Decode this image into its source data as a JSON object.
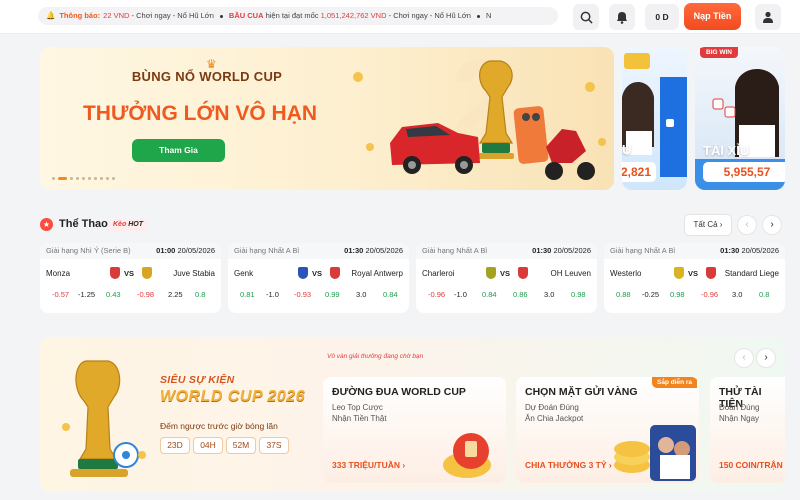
{
  "topbar": {
    "ticker": [
      {
        "label": "Thông báo:",
        "amount": "22 VND",
        "suffix": "- Chơi ngay - Nổ Hũ Lớn"
      },
      {
        "label": "BẦU CUA",
        "middle": " hiện tại đạt mốc ",
        "amount": "1,051,242,762 VND",
        "suffix": "- Chơi ngay - Nổ Hũ Lớn"
      },
      {
        "tail": "N"
      }
    ],
    "balance": "0 D",
    "deposit_label": "Nạp Tiền"
  },
  "hero": {
    "title1": "BÙNG NỔ WORLD CUP",
    "title2": "THƯỞNG LỚN VÔ HẠN",
    "cta": "Tham Gia",
    "dots": 10,
    "active_dot": 1
  },
  "side_banners": [
    {
      "title": "U",
      "amount": "2,821"
    },
    {
      "badge": "BIG WIN",
      "title": "TÀI XỈU",
      "amount": "5,955,57"
    }
  ],
  "sports": {
    "title": "Thể Thao",
    "badge_keo": "Kèo",
    "badge_hot": "HOT",
    "see_all": "Tất Cả",
    "matches": [
      {
        "league": "Giải hạng Nhì Ý (Serie B)",
        "time": "01:00",
        "date": "20/05/2026",
        "home": "Monza",
        "away": "Juve Stabia",
        "home_color": "#d93a3a",
        "away_color": "#d9a421",
        "odds": [
          "-0.57",
          "-1.25",
          "0.43",
          "-0.98",
          "2.25",
          "0.8"
        ]
      },
      {
        "league": "Giải hạng Nhất A Bỉ",
        "time": "01:30",
        "date": "20/05/2026",
        "home": "Genk",
        "away": "Royal Antwerp",
        "home_color": "#2a55b8",
        "away_color": "#d93a3a",
        "odds": [
          "0.81",
          "-1.0",
          "-0.93",
          "0.99",
          "3.0",
          "0.84"
        ]
      },
      {
        "league": "Giải hạng Nhất A Bỉ",
        "time": "01:30",
        "date": "20/05/2026",
        "home": "Charleroi",
        "away": "OH Leuven",
        "home_color": "#a3a321",
        "away_color": "#d93a3a",
        "odds": [
          "-0.96",
          "-1.0",
          "0.84",
          "0.86",
          "3.0",
          "0.98"
        ]
      },
      {
        "league": "Giải hạng Nhất A Bỉ",
        "time": "01:30",
        "date": "20/05/2026",
        "home": "Westerlo",
        "away": "Standard Liege",
        "home_color": "#d9b321",
        "away_color": "#d93a3a",
        "odds": [
          "0.88",
          "-0.25",
          "0.98",
          "-0.96",
          "3.0",
          "0.8"
        ]
      }
    ]
  },
  "promo": {
    "subtitle": "SIÊU SỰ KIỆN",
    "title": "WORLD CUP 2026",
    "countdown_label": "Đếm ngược trước giờ bóng lăn",
    "countdown": [
      "23D",
      "04H",
      "52M",
      "37S"
    ],
    "tagline": "Vô vàn giải thưởng đang chờ bạn",
    "cards": [
      {
        "title": "ĐƯỜNG ĐUA WORLD CUP",
        "line1": "Leo Top Cược",
        "line2": "Nhận Tiền Thật",
        "cta": "333 TRIỆU/TUẦN"
      },
      {
        "title": "CHỌN MẶT GỬI VÀNG",
        "badge": "Sắp diễn ra",
        "line1": "Dự Đoán Đúng",
        "line2": "Ăn Chia Jackpot",
        "cta": "CHIA THƯỞNG 3 TỶ"
      },
      {
        "title": "THỬ TÀI TIÊN",
        "line1": "Đoán Đúng",
        "line2": "Nhận Ngay",
        "cta": "150 COIN/TRẬN"
      }
    ]
  },
  "colors": {
    "accent": "#f24b1e",
    "green": "#1fa54a",
    "odds_red": "#e23b3b",
    "odds_green": "#1e9d4c"
  }
}
